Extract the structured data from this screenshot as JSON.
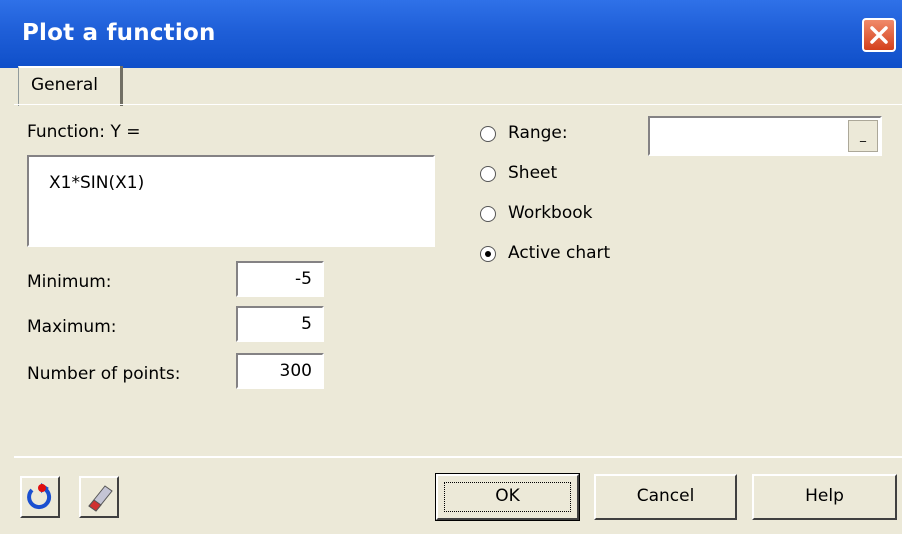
{
  "window": {
    "title": "Plot a function"
  },
  "tabs": [
    {
      "label": "General"
    }
  ],
  "function": {
    "label": "Function: Y =",
    "value": "X1*SIN(X1)"
  },
  "minimum": {
    "label": "Minimum:",
    "value": "-5"
  },
  "maximum": {
    "label": "Maximum:",
    "value": "5"
  },
  "points": {
    "label": "Number of points:",
    "value": "300"
  },
  "output": {
    "options": [
      {
        "label": "Range:",
        "selected": false
      },
      {
        "label": "Sheet",
        "selected": false
      },
      {
        "label": "Workbook",
        "selected": false
      },
      {
        "label": "Active chart",
        "selected": true
      }
    ],
    "range_value": "",
    "range_button": "_"
  },
  "buttons": {
    "ok": "OK",
    "cancel": "Cancel",
    "help": "Help"
  },
  "icons": {
    "reset": "refresh-icon",
    "clear": "eraser-icon",
    "close": "close-icon"
  },
  "colors": {
    "titlebar": "#0f4fc9",
    "close": "#d4401c",
    "face": "#ece9d8"
  }
}
